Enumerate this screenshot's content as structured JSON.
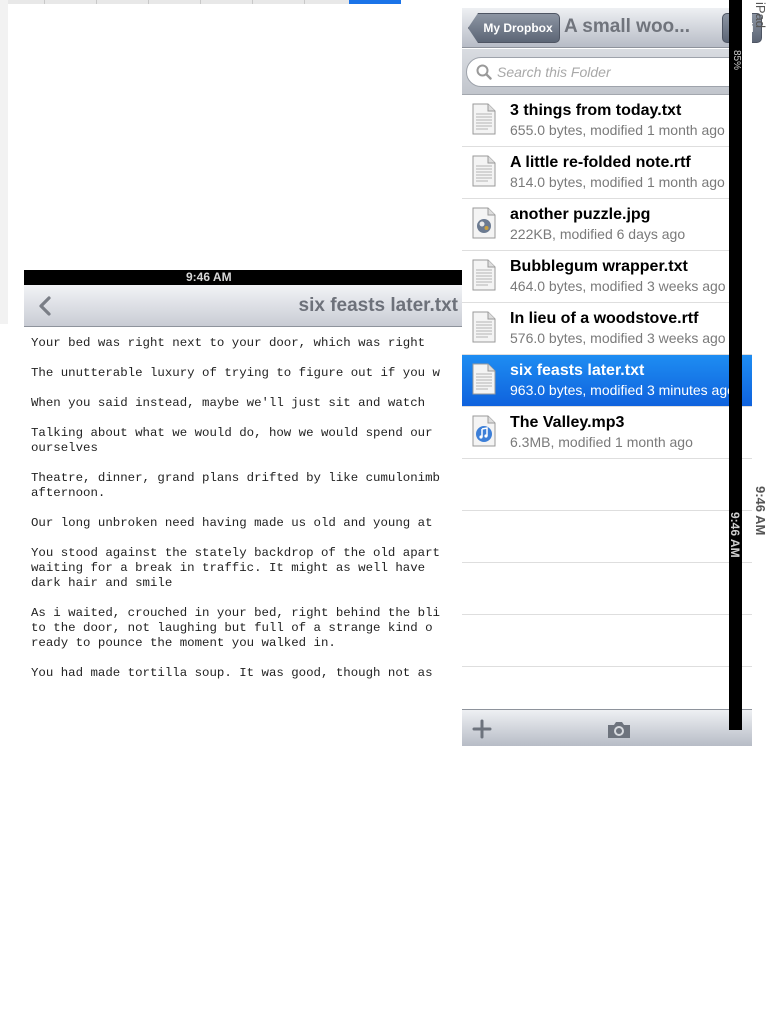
{
  "device": {
    "name": "iPad",
    "time": "9:46 AM",
    "battery": "85%"
  },
  "document": {
    "status_time": "9:46 AM",
    "title": "six feasts later.txt",
    "lines": [
      "Your bed was right next to your door, which was right",
      "The unutterable luxury of trying to figure out if you w",
      "When you said instead, maybe we'll just sit and watch",
      "Talking about what we would do, how we would spend our",
      "ourselves",
      "Theatre, dinner, grand plans drifted by like cumulonimb",
      "afternoon.",
      "Our long unbroken need having made us old and young at",
      "You stood against the stately backdrop of the old apart",
      "waiting for a break in traffic. It might as well have",
      "dark hair and smile",
      "As i waited, crouched in your bed, right behind the bli",
      "to the door, not laughing but full of a strange kind o",
      "ready to pounce the moment you walked in.",
      "You had made tortilla soup. It was good, though not as"
    ]
  },
  "dropbox": {
    "back_label": "My Dropbox",
    "title": "A small woo...",
    "edit_label": "Edi",
    "search_placeholder": "Search this Folder",
    "files": [
      {
        "name": "3 things from today.txt",
        "meta": "655.0 bytes, modified 1 month ago",
        "icon": "text-document-icon",
        "selected": false
      },
      {
        "name": "A little re-folded note.rtf",
        "meta": "814.0 bytes, modified 1 month ago",
        "icon": "text-document-icon",
        "selected": false
      },
      {
        "name": "another puzzle.jpg",
        "meta": "222KB, modified 6 days ago",
        "icon": "image-file-icon",
        "selected": false
      },
      {
        "name": "Bubblegum wrapper.txt",
        "meta": "464.0 bytes, modified 3 weeks ago",
        "icon": "text-document-icon",
        "selected": false
      },
      {
        "name": "In lieu of a woodstove.rtf",
        "meta": "576.0 bytes, modified 3 weeks ago",
        "icon": "text-document-icon",
        "selected": false
      },
      {
        "name": "six feasts later.txt",
        "meta": "963.0 bytes, modified 3 minutes ago",
        "icon": "text-document-icon",
        "selected": true
      },
      {
        "name": "The Valley.mp3",
        "meta": "6.3MB, modified 1 month ago",
        "icon": "audio-file-icon",
        "selected": false
      }
    ],
    "selected_color": "#1a7aeb"
  }
}
